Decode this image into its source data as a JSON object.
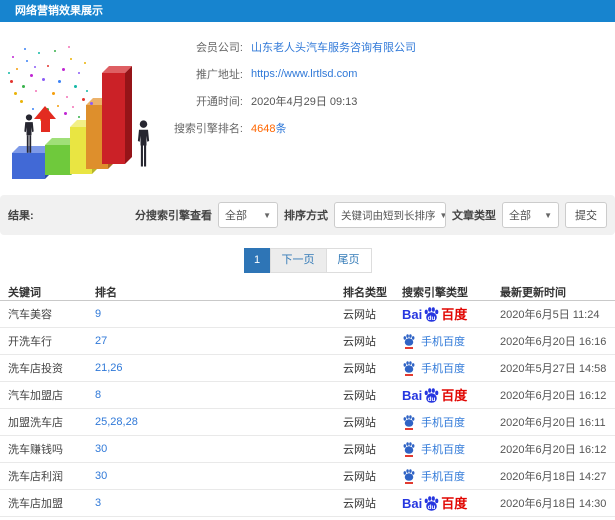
{
  "window": {
    "title": "网络营销效果展示"
  },
  "profile": {
    "fields": [
      {
        "label": "会员公司:",
        "value": "山东老人头汽车服务咨询有限公司"
      },
      {
        "label": "推广地址:",
        "value": "https://www.lrtlsd.com"
      },
      {
        "label": "开通时间:",
        "value": "2020年4月29日 09:13"
      },
      {
        "label": "搜索引擎排名:",
        "value": "4648",
        "suffix": "条"
      }
    ]
  },
  "filters": {
    "result_label": "结果:",
    "engine_view_label": "分搜索引擎查看",
    "engine_view_value": "全部",
    "sort_label": "排序方式",
    "sort_value": "关键词由短到长排序",
    "article_label": "文章类型",
    "article_value": "全部",
    "submit_label": "提交"
  },
  "pagination": {
    "current": "1",
    "next": "下一页",
    "last": "尾页"
  },
  "table": {
    "columns": [
      "关键词",
      "排名",
      "排名类型",
      "搜索引擎类型",
      "最新更新时间"
    ],
    "rows": [
      {
        "keyword": "汽车美容",
        "rank": "9",
        "rank_type": "云网站",
        "engine": "baidu-pc",
        "updated": "2020年6月5日 11:24"
      },
      {
        "keyword": "开洗车行",
        "rank": "27",
        "rank_type": "云网站",
        "engine": "baidu-mobile",
        "updated": "2020年6月20日 16:16"
      },
      {
        "keyword": "洗车店投资",
        "rank": "21,26",
        "rank_type": "云网站",
        "engine": "baidu-mobile",
        "updated": "2020年5月27日 14:58"
      },
      {
        "keyword": "汽车加盟店",
        "rank": "8",
        "rank_type": "云网站",
        "engine": "baidu-pc",
        "updated": "2020年6月20日 16:12"
      },
      {
        "keyword": "加盟洗车店",
        "rank": "25,28,28",
        "rank_type": "云网站",
        "engine": "baidu-mobile",
        "updated": "2020年6月20日 16:11"
      },
      {
        "keyword": "洗车赚钱吗",
        "rank": "30",
        "rank_type": "云网站",
        "engine": "baidu-mobile",
        "updated": "2020年6月20日 16:12"
      },
      {
        "keyword": "洗车店利润",
        "rank": "30",
        "rank_type": "云网站",
        "engine": "baidu-mobile",
        "updated": "2020年6月18日 14:27"
      },
      {
        "keyword": "洗车店加盟",
        "rank": "3",
        "rank_type": "云网站",
        "engine": "baidu-pc",
        "updated": "2020年6月18日 14:30"
      }
    ]
  },
  "engine_labels": {
    "pc_bai": "Bai",
    "pc_du": "du",
    "pc_cn": "百度",
    "mobile": "手机百度"
  },
  "colors": {
    "header_bg": "#1784cf",
    "link_blue": "#3079d8",
    "highlight_orange": "#ff6600",
    "baidu_blue": "#2636e0",
    "baidu_red": "#e10602",
    "pagination_active": "#2e75b6",
    "filter_bar_bg": "#f1f1f1"
  }
}
